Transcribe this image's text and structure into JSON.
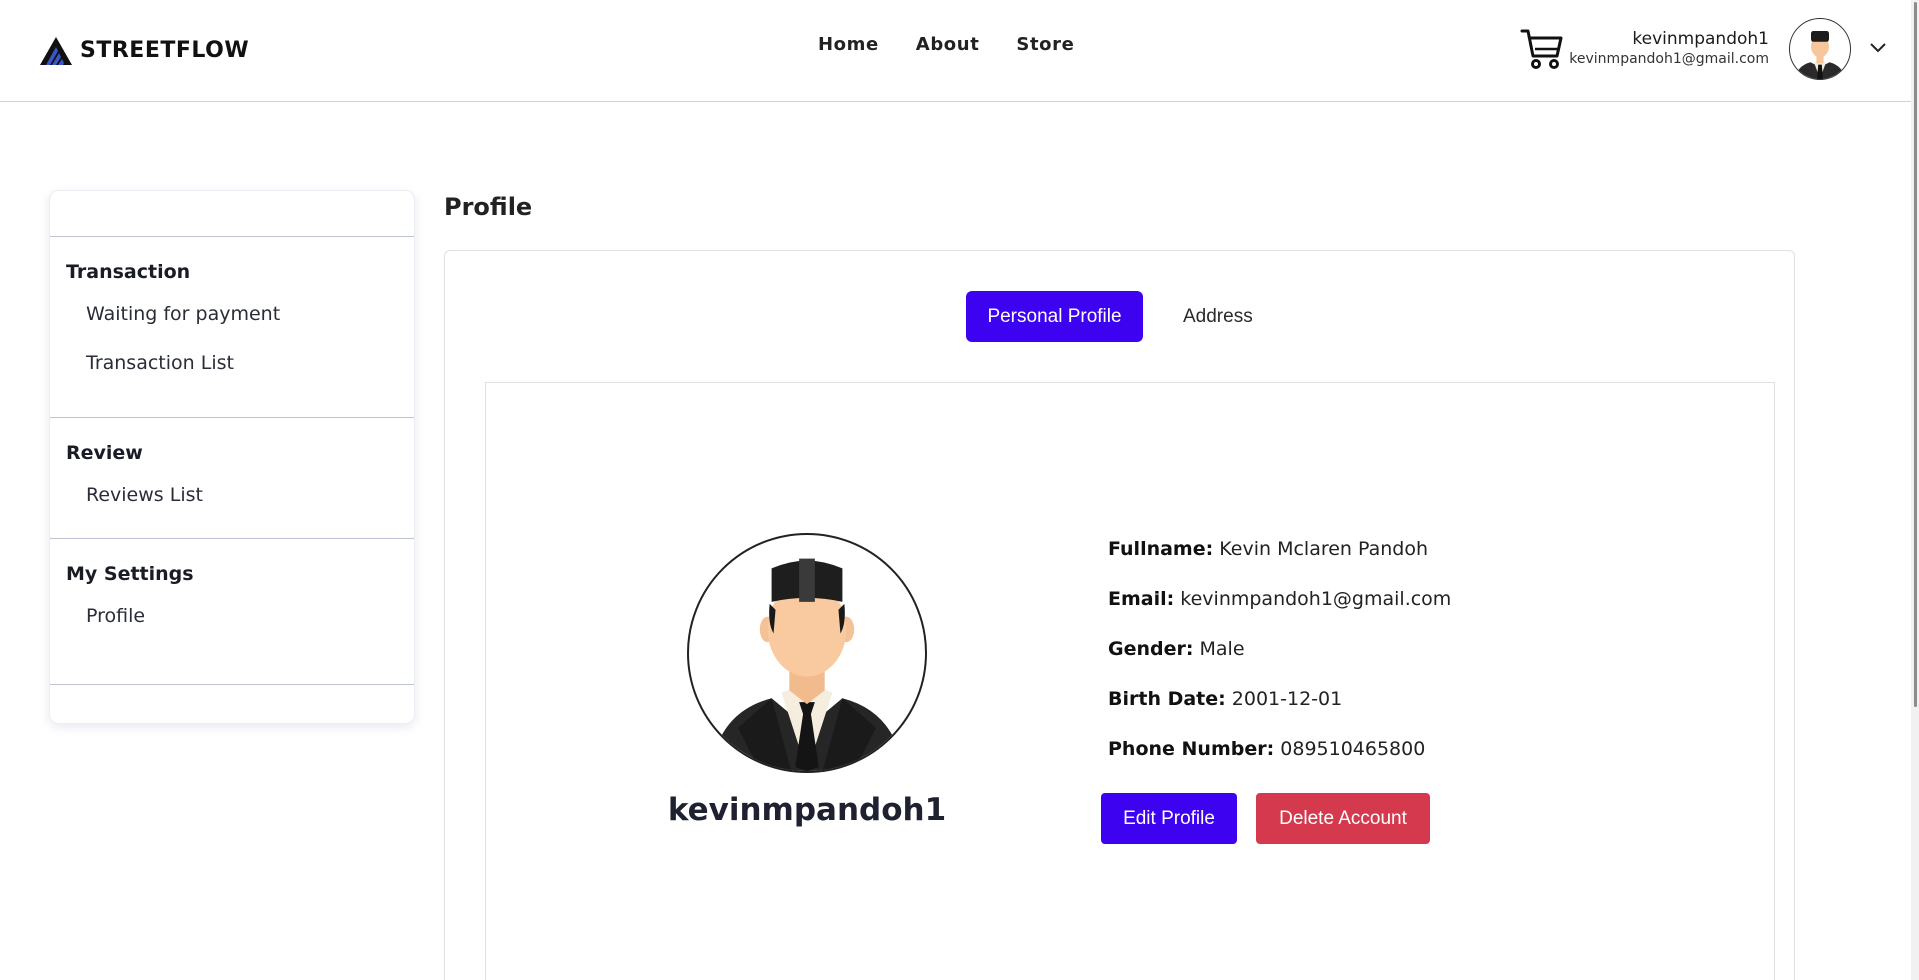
{
  "header": {
    "brand": "STREETFLOW",
    "nav": [
      {
        "label": "Home"
      },
      {
        "label": "About"
      },
      {
        "label": "Store"
      }
    ],
    "user": {
      "username": "kevinmpandoh1",
      "email": "kevinmpandoh1@gmail.com"
    },
    "icons": {
      "cart": "cart-icon",
      "dropdown": "chevron-down-icon"
    }
  },
  "sidebar": {
    "sections": [
      {
        "heading": "Transaction",
        "items": [
          {
            "label": "Waiting for payment"
          },
          {
            "label": "Transaction List"
          }
        ]
      },
      {
        "heading": "Review",
        "items": [
          {
            "label": "Reviews List"
          }
        ]
      },
      {
        "heading": "My Settings",
        "items": [
          {
            "label": "Profile"
          }
        ]
      }
    ]
  },
  "main": {
    "title": "Profile",
    "tabs": [
      {
        "label": "Personal Profile",
        "active": true
      },
      {
        "label": "Address",
        "active": false
      }
    ],
    "profile": {
      "username": "kevinmpandoh1",
      "fields": [
        {
          "label": "Fullname:",
          "value": "Kevin Mclaren Pandoh"
        },
        {
          "label": "Email:",
          "value": "kevinmpandoh1@gmail.com"
        },
        {
          "label": "Gender:",
          "value": "Male"
        },
        {
          "label": "Birth Date:",
          "value": "2001-12-01"
        },
        {
          "label": "Phone Number:",
          "value": "089510465800"
        }
      ],
      "edit_label": "Edit Profile",
      "delete_label": "Delete Account"
    }
  },
  "colors": {
    "primary": "#3d02f0",
    "danger": "#d4394d",
    "border": "#dfe1e6"
  }
}
